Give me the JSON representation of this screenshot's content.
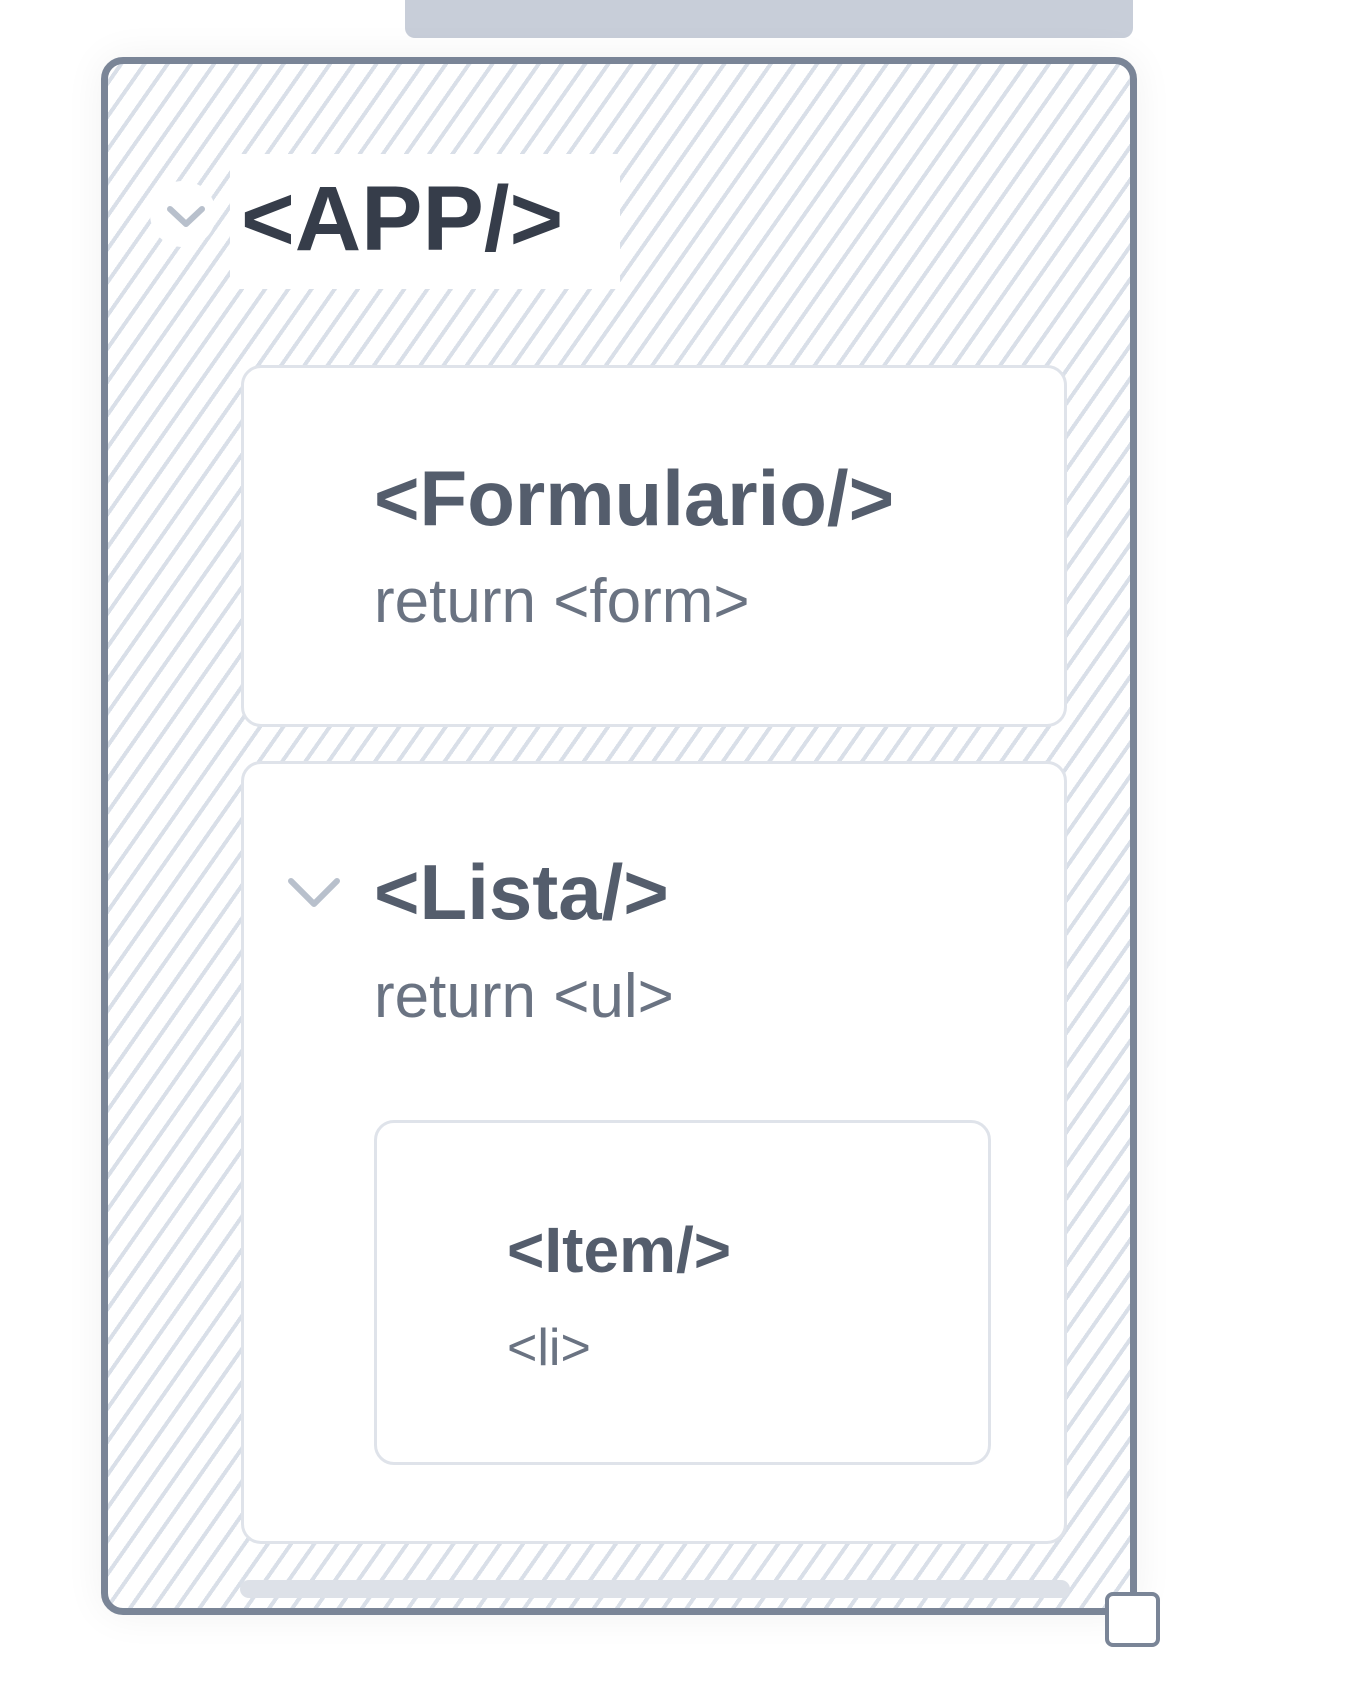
{
  "app": {
    "title": "<APP/>"
  },
  "formulario": {
    "title": "<Formulario/>",
    "subtitle": "return <form>"
  },
  "lista": {
    "title": "<Lista/>",
    "subtitle": "return <ul>"
  },
  "item": {
    "title": "<Item/>",
    "subtitle": "<li>"
  },
  "icons": {
    "app_toggle": "chevron-down-icon",
    "lista_toggle": "chevron-down-icon"
  },
  "colors": {
    "frame_border": "#7a8597",
    "hatch": "#d9dfe8",
    "title_dark": "#363d4a",
    "title": "#545d6c",
    "subtitle": "#6a7382",
    "card_border": "#dfe3ea"
  }
}
